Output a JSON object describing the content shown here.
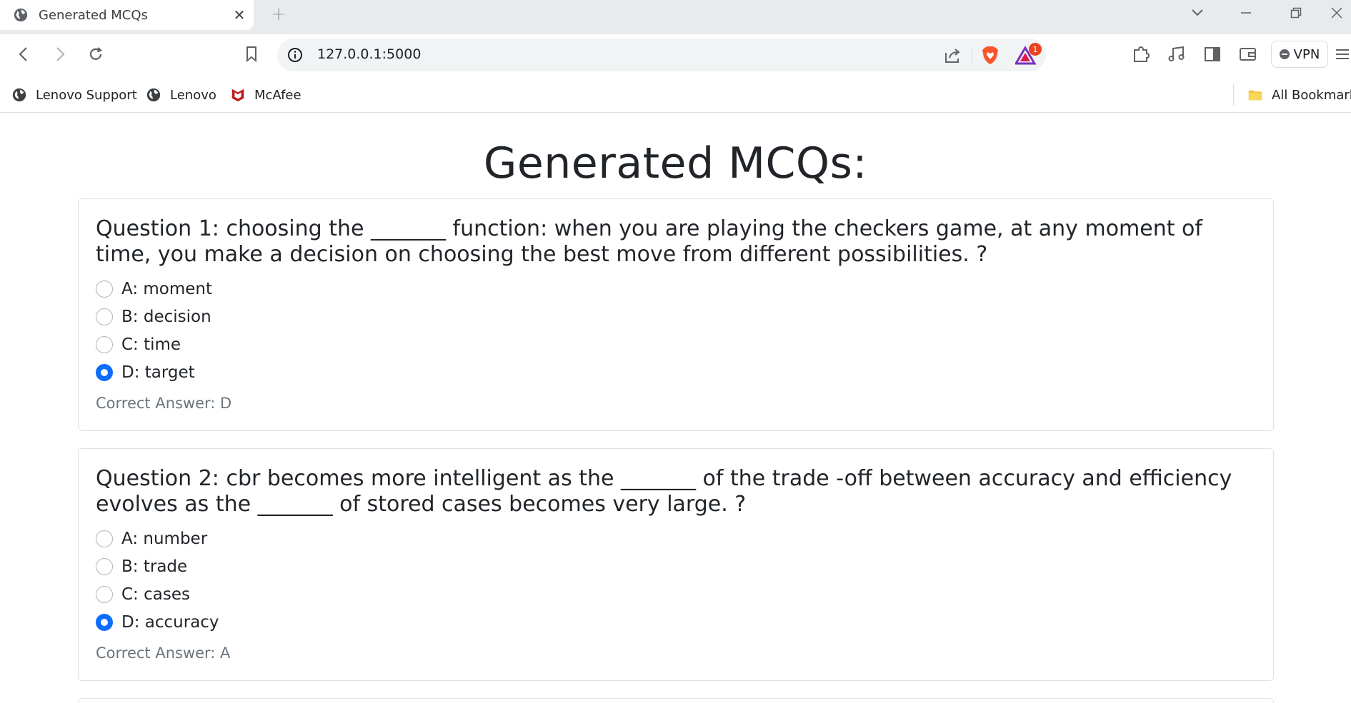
{
  "browser": {
    "tab_title": "Generated MCQs",
    "url": "127.0.0.1:5000",
    "alert_badge": "1",
    "vpn_label": "VPN",
    "bookmarks": [
      {
        "label": "Lenovo Support",
        "icon": "globe-icon"
      },
      {
        "label": "Lenovo",
        "icon": "globe-icon"
      },
      {
        "label": "McAfee",
        "icon": "mcafee-icon"
      }
    ],
    "all_bookmarks": "All Bookmarks",
    "accent_color": "#0d6efd"
  },
  "page": {
    "title": "Generated MCQs:",
    "questions": [
      {
        "text": "Question 1: choosing the _______ function: when you are playing the checkers game, at any moment of time, you make a decision on choosing the best move from different possibilities. ?",
        "options": [
          "A: moment",
          "B: decision",
          "C: time",
          "D: target"
        ],
        "selected_option": "D: target",
        "correct_answer": "Correct Answer: D"
      },
      {
        "text": "Question 2: cbr becomes more intelligent as the _______ of the trade -off between accuracy and efficiency evolves as the _______ of stored cases becomes very large. ?",
        "options": [
          "A: number",
          "B: trade",
          "C: cases",
          "D: accuracy"
        ],
        "selected_option": "D: accuracy",
        "correct_answer": "Correct Answer: A"
      }
    ]
  }
}
